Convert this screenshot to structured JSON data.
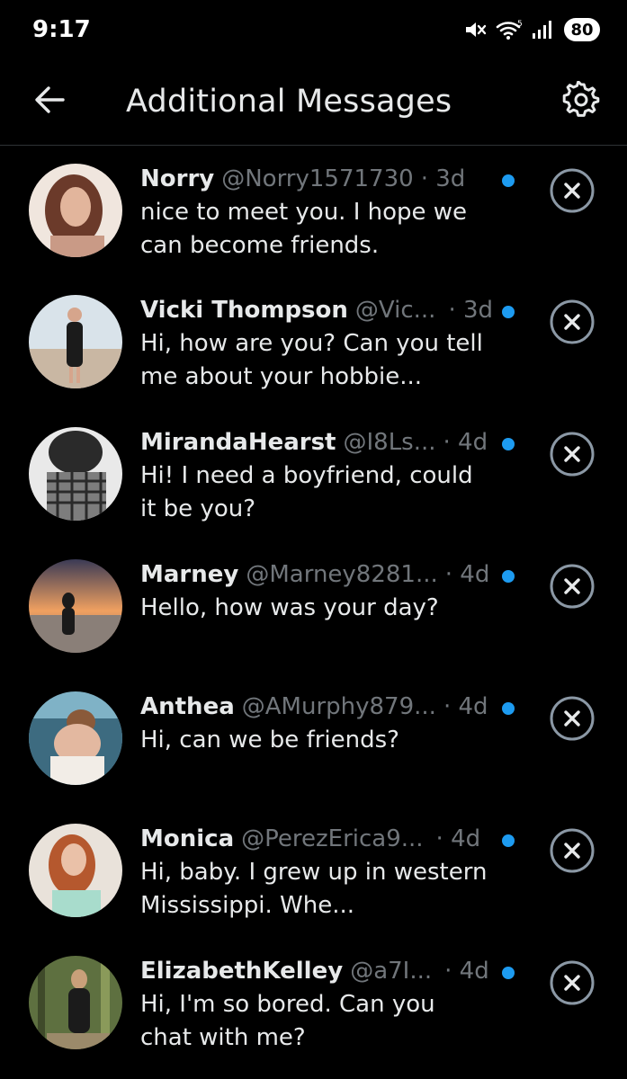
{
  "status_bar": {
    "time": "9:17",
    "battery": "80",
    "icons": [
      "mute-icon",
      "wifi-icon",
      "signal-icon",
      "battery-icon"
    ]
  },
  "header": {
    "title": "Additional Messages",
    "back_icon": "back-arrow-icon",
    "settings_icon": "gear-icon"
  },
  "colors": {
    "background": "#000000",
    "primary_text": "#e7e9ea",
    "secondary_text": "#71767b",
    "unread_dot": "#1d9bf0",
    "divider": "#2f3336"
  },
  "messages": [
    {
      "name": "Norry",
      "handle": "@Norry1571730",
      "time": "· 3d",
      "text": "nice to meet you. I hope we can become friends.",
      "unread": true,
      "avatar_colors": [
        "#c99a86",
        "#6b3a2a",
        "#f0e6de"
      ]
    },
    {
      "name": "Vicki Thompson",
      "handle": "@Vic...",
      "time": "· 3d",
      "text": "Hi, how are you? Can you tell me about your hobbie...",
      "unread": true,
      "avatar_colors": [
        "#d9e3ea",
        "#1b1b1b",
        "#c9b7a3"
      ]
    },
    {
      "name": "MirandaHearst",
      "handle": "@I8Ls...",
      "time": "· 4d",
      "text": "Hi! I need a boyfriend, could it be you?",
      "unread": true,
      "avatar_colors": [
        "#e9e9e9",
        "#2a2a2a",
        "#7d7d7d"
      ]
    },
    {
      "name": "Marney",
      "handle": "@Marney8281...",
      "time": "· 4d",
      "text": "Hello, how was your day?",
      "unread": true,
      "avatar_colors": [
        "#f0a060",
        "#3a3a55",
        "#1a1a1a"
      ]
    },
    {
      "name": "Anthea",
      "handle": "@AMurphy879...",
      "time": "· 4d",
      "text": "Hi, can we be friends?",
      "unread": true,
      "avatar_colors": [
        "#7fb2c6",
        "#3d6b80",
        "#f2ede7"
      ]
    },
    {
      "name": "Monica",
      "handle": "@PerezErica9...",
      "time": "· 4d",
      "text": "Hi, baby. I grew up in western Mississippi. Whe...",
      "unread": true,
      "avatar_colors": [
        "#e9e2da",
        "#b5582e",
        "#a8dccc"
      ]
    },
    {
      "name": "ElizabethKelley",
      "handle": "@a7I...",
      "time": "· 4d",
      "text": "Hi, I'm so bored. Can you chat with me?",
      "unread": true,
      "avatar_colors": [
        "#5e7040",
        "#1b1b1b",
        "#8a9a5a"
      ]
    }
  ]
}
